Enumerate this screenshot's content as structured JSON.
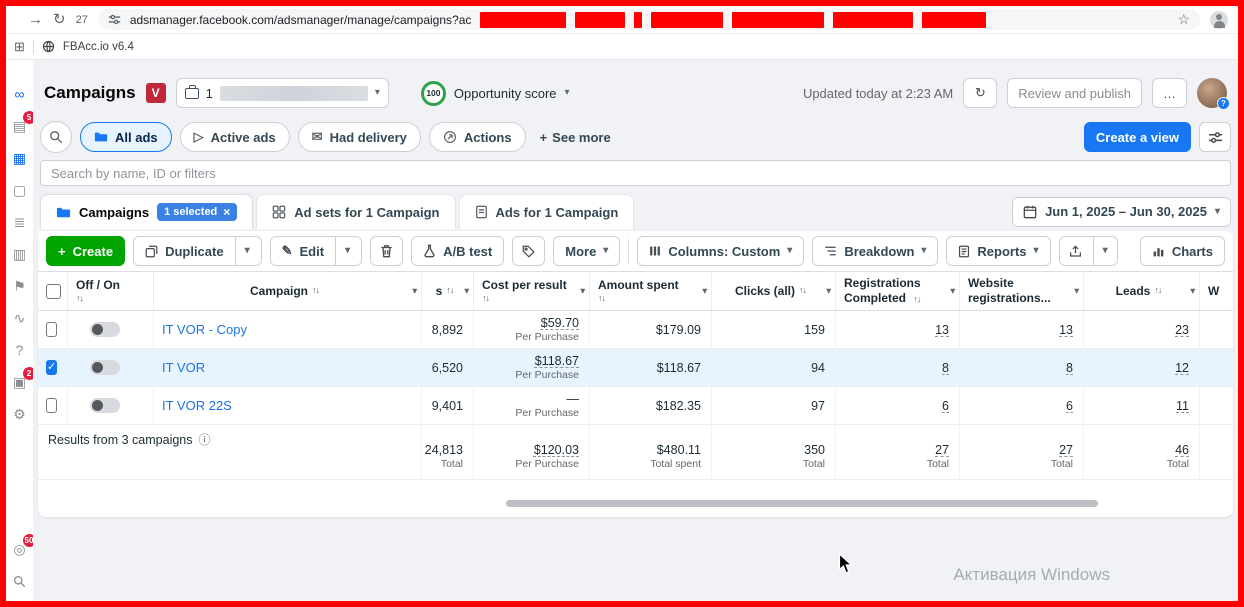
{
  "browser": {
    "tab_count": "27",
    "url": "adsmanager.facebook.com/adsmanager/manage/campaigns?ac"
  },
  "fbacc": {
    "label": "FBAcc.io v6.4"
  },
  "icons": {
    "caret": "▾",
    "sort": "↑↓",
    "check": "✓",
    "close": "×",
    "plus": "+",
    "star": "☆",
    "forward": "→",
    "reload": "↻",
    "info": "ⓘ",
    "ellipsis": "…",
    "envelope": "✉",
    "play": "▷",
    "pencil": "✎",
    "apps": "⊞"
  },
  "sidebar": {
    "icons": [
      {
        "name": "meta",
        "glyph": "∞"
      },
      {
        "name": "notifications",
        "glyph": "▤",
        "badge": "5"
      },
      {
        "name": "ads-manager",
        "glyph": "▦"
      },
      {
        "name": "pages",
        "glyph": "▢"
      },
      {
        "name": "lists",
        "glyph": "≣"
      },
      {
        "name": "assets",
        "glyph": "▥"
      },
      {
        "name": "flags",
        "glyph": "⚑"
      },
      {
        "name": "analytics",
        "glyph": "∿"
      },
      {
        "name": "help",
        "glyph": "?"
      },
      {
        "name": "inbox",
        "glyph": "▣",
        "badge": "2"
      },
      {
        "name": "settings",
        "glyph": "⚙"
      },
      {
        "name": "counter",
        "glyph": "◎",
        "badge": "50"
      }
    ]
  },
  "header": {
    "title": "Campaigns",
    "account_badge": "V",
    "account_number": "1",
    "opportunity_score": "100",
    "opportunity_label": "Opportunity score",
    "updated": "Updated today at 2:23 AM",
    "review_publish": "Review and publish",
    "more": "…"
  },
  "filters": {
    "all_ads": "All ads",
    "active_ads": "Active ads",
    "had_delivery": "Had delivery",
    "actions": "Actions",
    "see_more": "See more",
    "create_view": "Create a view"
  },
  "search": {
    "placeholder": "Search by name, ID or filters"
  },
  "tabs": {
    "campaigns": "Campaigns",
    "selected_badge": "1 selected",
    "adsets": "Ad sets for 1 Campaign",
    "ads": "Ads for 1 Campaign"
  },
  "daterange": "Jun 1, 2025 – Jun 30, 2025",
  "toolbar": {
    "create": "Create",
    "duplicate": "Duplicate",
    "edit": "Edit",
    "ab_test": "A/B test",
    "more": "More",
    "columns": "Columns: Custom",
    "breakdown": "Breakdown",
    "reports": "Reports",
    "charts": "Charts"
  },
  "table": {
    "headers": {
      "off_on": "Off / On",
      "campaign": "Campaign",
      "results_partial": "s",
      "cost": "Cost per result",
      "spent": "Amount spent",
      "clicks": "Clicks (all)",
      "registrations_1": "Registrations",
      "registrations_2": "Completed",
      "website_1": "Website",
      "website_2": "registrations...",
      "leads": "Leads",
      "next_partial": "W"
    },
    "rows": [
      {
        "name": "IT VOR - Copy",
        "results": "8,892",
        "cost": "$59.70",
        "cost_sub": "Per Purchase",
        "spent": "$179.09",
        "clicks": "159",
        "registrations": "13",
        "website": "13",
        "leads": "23"
      },
      {
        "name": "IT VOR",
        "results": "6,520",
        "cost": "$118.67",
        "cost_sub": "Per Purchase",
        "spent": "$118.67",
        "clicks": "94",
        "registrations": "8",
        "website": "8",
        "leads": "12"
      },
      {
        "name": "IT VOR 22S",
        "results": "9,401",
        "cost": "—",
        "cost_sub": "Per Purchase",
        "spent": "$182.35",
        "clicks": "97",
        "registrations": "6",
        "website": "6",
        "leads": "11"
      }
    ],
    "summary": {
      "label": "Results from 3 campaigns",
      "results": "24,813",
      "results_sub": "Total",
      "cost": "$120.03",
      "cost_sub": "Per Purchase",
      "spent": "$480.11",
      "spent_sub": "Total spent",
      "clicks": "350",
      "clicks_sub": "Total",
      "registrations": "27",
      "registrations_sub": "Total",
      "website": "27",
      "website_sub": "Total",
      "leads": "46",
      "leads_sub": "Total"
    }
  },
  "watermark": "Активация Windows",
  "colors": {
    "frame_red": "#fe0000",
    "accent_blue": "#1877f2",
    "create_green": "#00a400",
    "selected_row": "#e7f3ff",
    "link_blue": "#1b74e4"
  }
}
